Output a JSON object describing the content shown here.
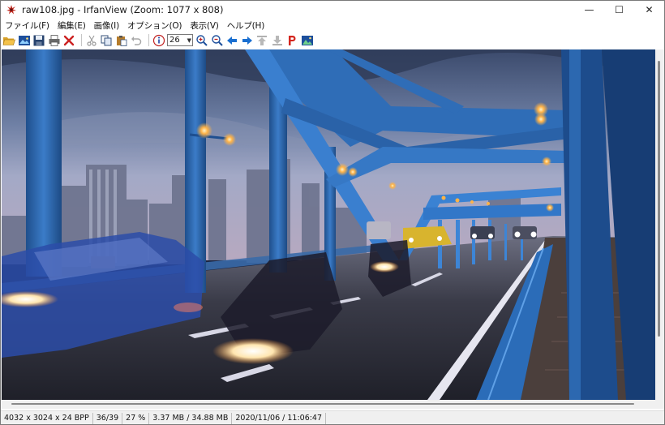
{
  "window": {
    "title": "raw108.jpg - IrfanView (Zoom: 1077 x 808)",
    "controls": {
      "minimize": "—",
      "maximize": "☐",
      "close": "✕"
    }
  },
  "menu": [
    "ファイル(F)",
    "編集(E)",
    "画像(I)",
    "オプション(O)",
    "表示(V)",
    "ヘルプ(H)"
  ],
  "toolbar": {
    "zoom_value": "26"
  },
  "status": {
    "dimensions": "4032 x 3024 x 24 BPP",
    "index": "36/39",
    "zoom": "27 %",
    "size": "3.37 MB / 34.88 MB",
    "datetime": "2020/11/06 / 11:06:47"
  },
  "colors": {
    "sky_top": "#3a4a6a",
    "bridge_blue": "#2e6eb8",
    "road": "#2a2a33",
    "accent_red": "#cc2222",
    "toolbar_blue": "#1a6fd0"
  },
  "icons": [
    "open-icon",
    "thumbnails-icon",
    "save-icon",
    "print-icon",
    "delete-icon",
    "cut-icon",
    "copy-icon",
    "paste-icon",
    "undo-icon",
    "info-icon",
    "zoom-in-icon",
    "zoom-out-icon",
    "prev-icon",
    "next-icon",
    "first-icon",
    "last-icon",
    "paint-icon",
    "slideshow-icon"
  ]
}
